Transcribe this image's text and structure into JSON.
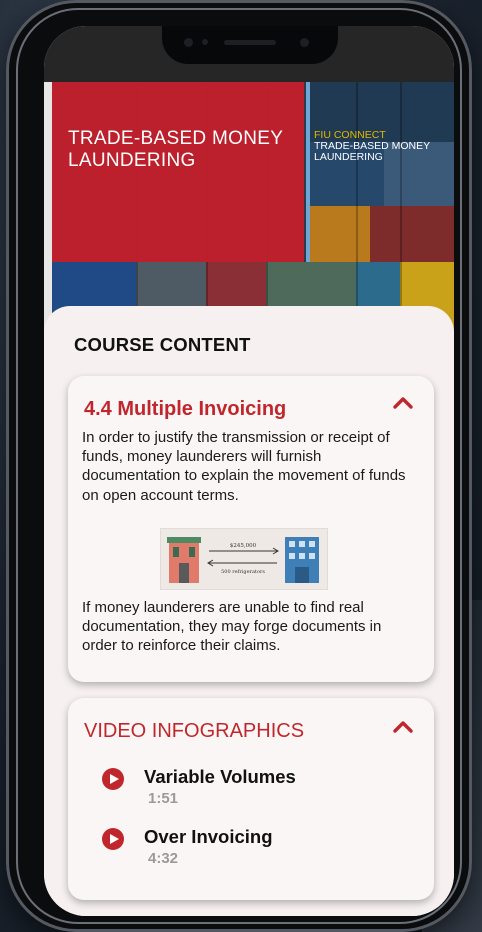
{
  "hero": {
    "title": "TRADE-BASED MONEY LAUNDERING",
    "brand": "FIU CONNECT",
    "brand_sub": "TRADE-BASED MONEY LAUNDERING"
  },
  "course": {
    "heading": "COURSE CONTENT",
    "lesson": {
      "title": "4.4 Multiple Invoicing",
      "paragraph1": "In order to justify the transmission or receipt of funds, money launderers will furnish documentation to explain the movement of funds on open account terms.",
      "illustration": {
        "amount_label": "$245,000",
        "goods_label": "500 refrigerators"
      },
      "paragraph2": "If money launderers are unable to find real documentation, they may forge documents in order to reinforce their claims."
    }
  },
  "videos": {
    "heading": "VIDEO INFOGRAPHICS",
    "items": [
      {
        "title": "Variable Volumes",
        "duration": "1:51"
      },
      {
        "title": "Over Invoicing",
        "duration": "4:32"
      }
    ]
  },
  "colors": {
    "accent": "#c0272d",
    "hero_red": "#c81e2a",
    "brand_gold": "#e2b700"
  }
}
